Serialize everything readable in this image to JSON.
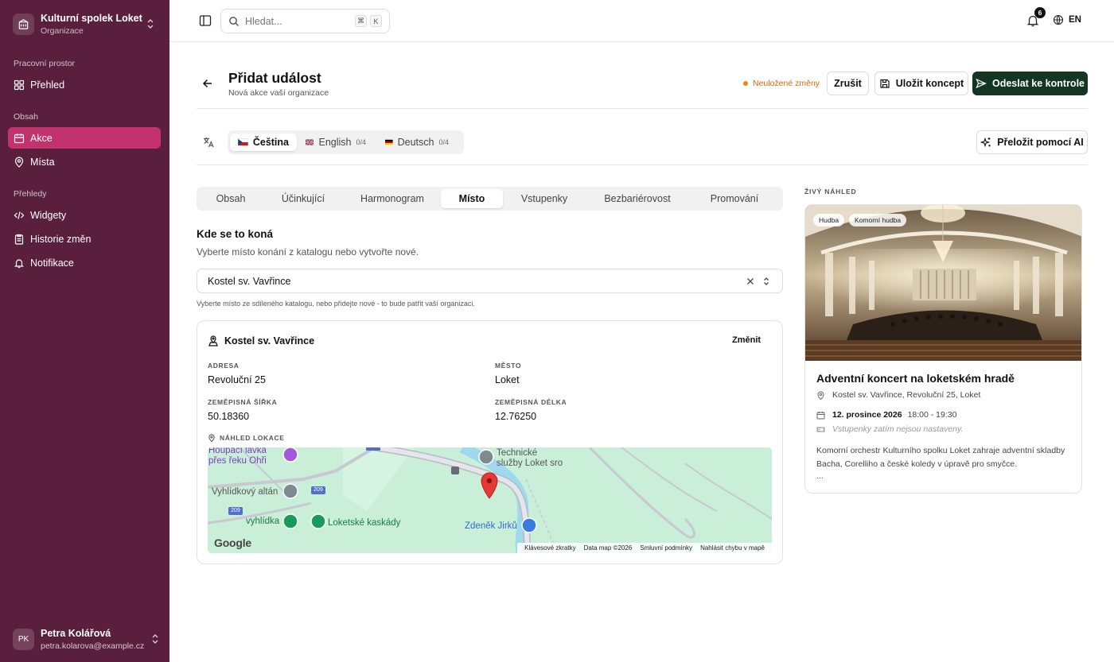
{
  "sidebar": {
    "org_name": "Kulturní spolek Loket",
    "org_sub": "Organizace",
    "sections": {
      "workspace": "Pracovní prostor",
      "content": "Obsah",
      "reports": "Přehledy"
    },
    "items": {
      "overview": "Přehled",
      "events": "Akce",
      "places": "Místa",
      "widgets": "Widgety",
      "history": "Historie změn",
      "notifications": "Notifikace"
    },
    "user": {
      "initials": "PK",
      "name": "Petra Kolářová",
      "email": "petra.kolarova@example.cz"
    }
  },
  "topbar": {
    "search_placeholder": "Hledat...",
    "shortcut": [
      "⌘",
      "K"
    ],
    "notif_count": "6",
    "language": "EN"
  },
  "header": {
    "title": "Přidat událost",
    "subtitle": "Nová akce vaší organizace",
    "unsaved": "Neuložené změny",
    "cancel": "Zrušit",
    "save_draft": "Uložit koncept",
    "submit": "Odeslat ke kontrole"
  },
  "languages": {
    "tabs": [
      {
        "label": "Čeština",
        "count": ""
      },
      {
        "label": "English",
        "count": "0/4"
      },
      {
        "label": "Deutsch",
        "count": "0/4"
      }
    ],
    "ai_button": "Přeložit pomocí AI"
  },
  "section_tabs": [
    "Obsah",
    "Účinkující",
    "Harmonogram",
    "Místo",
    "Vstupenky",
    "Bezbariérovost",
    "Promování"
  ],
  "active_section": "Místo",
  "venue": {
    "heading": "Kde se to koná",
    "description": "Vyberte místo konání z katalogu nebo vytvořte nové.",
    "selected": "Kostel sv. Vavřince",
    "hint": "Vyberte místo ze sdíleného katalogu, nebo přidejte nové - to bude patřit vaší organizaci.",
    "card": {
      "name": "Kostel sv. Vavřince",
      "change": "Změnit",
      "address_label": "ADRESA",
      "address": "Revoluční 25",
      "city_label": "MĚSTO",
      "city": "Loket",
      "lat_label": "ZEMĚPISNÁ ŠÍŘKA",
      "lat": "50.18360",
      "lng_label": "ZEMĚPISNÁ DÉLKA",
      "lng": "12.76250",
      "map_label": "NÁHLED LOKACE"
    },
    "map": {
      "places": {
        "houpaci": "Houpací lávka",
        "houpaci2": "přes řeku Ohři",
        "technicke": "Technické",
        "technicke2": "služby Loket sro",
        "vyhlidkovy": "Vyhlídkový altán",
        "vyhlidka": "vyhlídka",
        "kaskady": "Loketské kaskády",
        "jirku": "Zdeněk Jirků"
      },
      "roads": [
        "209",
        "209",
        "209"
      ],
      "logo": "Google",
      "footer": [
        "Klávesové zkratky",
        "Data map ©2026",
        "Smluvní podmínky",
        "Nahlásit chybu v mapě"
      ]
    }
  },
  "preview": {
    "label": "ŽIVÝ NÁHLED",
    "tags": [
      "Hudba",
      "Komorní hudba"
    ],
    "title": "Adventní koncert na loketském hradě",
    "location": "Kostel sv. Vavřince, Revoluční 25, Loket",
    "date": "12. prosince 2026",
    "time": "18:00 - 19:30",
    "tickets": "Vstupenky zatím nejsou nastaveny.",
    "description": "Komorní orchestr Kulturního spolku Loket zahraje adventní skladby Bacha, Corelliho a české koledy v úpravě pro smyčce.",
    "ellipsis": "..."
  },
  "colors": {
    "sidebar": "#5a1f3c",
    "active_item": "#c2336e",
    "primary_button": "#123524",
    "unsaved": "#f0880a"
  }
}
